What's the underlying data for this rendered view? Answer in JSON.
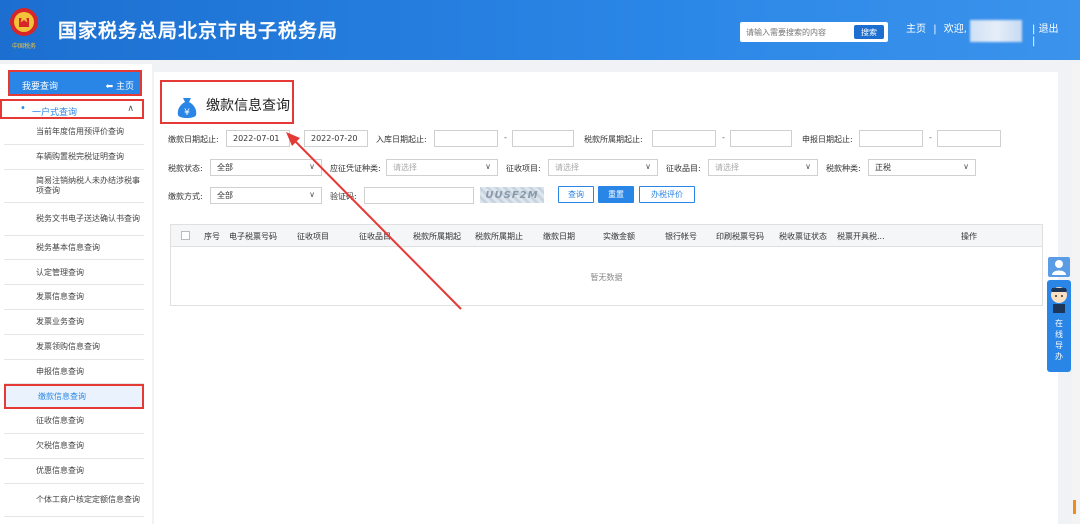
{
  "header": {
    "title": "国家税务总局北京市电子税务局",
    "emblem_caption": "中国税务",
    "search_placeholder": "请输入需要搜索的内容",
    "search_button": "搜索",
    "home_link": "主页",
    "welcome": "欢迎,",
    "logout": "退出",
    "separator": "|"
  },
  "sidebar": {
    "header_title": "我要查询",
    "home_label": "主页",
    "group_label": "一户式查询",
    "items": [
      "当前年度信用预评价查询",
      "车辆购置税完税证明查询",
      "简易注销纳税人未办结涉税事项查询",
      "税务文书电子送达确认书查询",
      "税务基本信息查询",
      "认定管理查询",
      "发票信息查询",
      "发票业务查询",
      "发票领购信息查询",
      "申报信息查询",
      "缴款信息查询",
      "征收信息查询",
      "欠税信息查询",
      "优惠信息查询",
      "个体工商户核定定额信息查询"
    ]
  },
  "page": {
    "title": "缴款信息查询"
  },
  "form": {
    "pay_date_start_label": "缴款日期起止:",
    "pay_date_start": "2022-07-01",
    "pay_date_end": "2022-07-20",
    "storage_date_label": "入库日期起止:",
    "tax_period_label": "税款所属期起止:",
    "declare_date_label": "申报日期起止:",
    "tax_status_label": "税款状态:",
    "tax_status_value": "全部",
    "voucher_type_label": "应征凭证种类:",
    "voucher_type_placeholder": "请选择",
    "collect_item_label": "征收项目:",
    "collect_item_placeholder": "请选择",
    "collect_product_label": "征收品目:",
    "collect_product_placeholder": "请选择",
    "tax_kind_label": "税款种类:",
    "tax_kind_value": "正税",
    "pay_method_label": "缴款方式:",
    "pay_method_value": "全部",
    "captcha_label": "验证码:",
    "captcha_text": "UUSF2M",
    "btn_query": "查询",
    "btn_reset": "重置",
    "btn_evaluate": "办税评价",
    "dash": "-"
  },
  "table": {
    "columns": [
      "序号",
      "电子税票号码",
      "征收项目",
      "征收品目",
      "税款所属期起",
      "税款所属期止",
      "缴款日期",
      "实缴金额",
      "银行帐号",
      "印刷税票号码",
      "税收票证状态",
      "税票开具税...",
      "操作"
    ],
    "empty_text": "暂无数据"
  },
  "right_widget": {
    "help_text": [
      "在",
      "线",
      "导",
      "办"
    ]
  },
  "colors": {
    "brand_blue": "#2a86e6",
    "highlight_red": "#e53935"
  }
}
